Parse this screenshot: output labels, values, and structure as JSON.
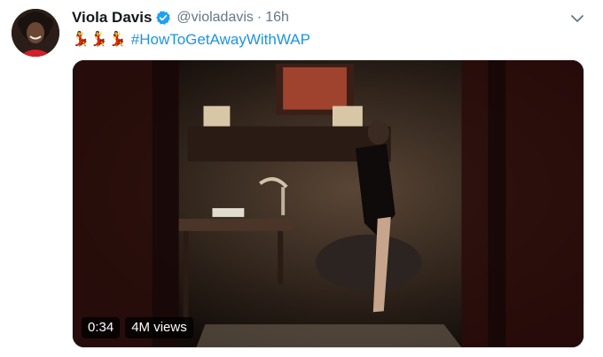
{
  "author": {
    "name": "Viola Davis",
    "handle": "@violadavis",
    "separator": "·",
    "time": "16h",
    "verified_icon": "verified-badge-icon",
    "badge_color": "#1da1f2"
  },
  "tweet": {
    "emojis": [
      "💃",
      "💃",
      "💃"
    ],
    "hashtag": "#HowToGetAwayWithWAP",
    "link_color": "#1b95e0"
  },
  "menu": {
    "icon": "chevron-down-icon"
  },
  "video": {
    "duration": "0:34",
    "views": "4M views"
  }
}
